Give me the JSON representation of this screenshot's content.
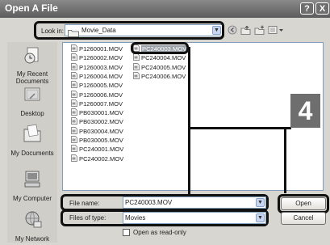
{
  "window": {
    "title": "Open A File",
    "help_label": "?",
    "close_label": "X"
  },
  "toolbar": {
    "lookin_label": "Look in:",
    "lookin_value": "Movie_Data",
    "icons": [
      "back-icon",
      "up-folder-icon",
      "new-folder-icon",
      "views-menu-icon"
    ]
  },
  "places": [
    {
      "label": "My Recent Documents",
      "line1": "My Recent",
      "line2": "Documents",
      "icon": "recent-documents-icon"
    },
    {
      "label": "Desktop",
      "line1": "Desktop",
      "line2": "",
      "icon": "desktop-icon"
    },
    {
      "label": "My Documents",
      "line1": "My Documents",
      "line2": "",
      "icon": "my-documents-icon"
    },
    {
      "label": "My Computer",
      "line1": "My Computer",
      "line2": "",
      "icon": "my-computer-icon"
    },
    {
      "label": "My Network",
      "line1": "My Network",
      "line2": "",
      "icon": "my-network-icon"
    }
  ],
  "files": {
    "column1": [
      "P1260001.MOV",
      "P1260002.MOV",
      "P1260003.MOV",
      "P1260004.MOV",
      "P1260005.MOV",
      "P1260006.MOV",
      "P1260007.MOV",
      "PB030001.MOV",
      "PB030002.MOV",
      "PB030004.MOV",
      "PB030005.MOV",
      "PC240001.MOV",
      "PC240002.MOV"
    ],
    "column2": [
      "PC240003.MOV",
      "PC240004.MOV",
      "PC240005.MOV",
      "PC240006.MOV"
    ],
    "selected": "PC240003.MOV"
  },
  "step_badge": "4",
  "form": {
    "file_name_label": "File name:",
    "file_name_value": "PC240003.MOV",
    "file_type_label": "Files of type:",
    "file_type_value": "Movies",
    "readonly_label": "Open as read-only",
    "readonly_checked": false
  },
  "buttons": {
    "open": "Open",
    "cancel": "Cancel"
  },
  "colors": {
    "callout": "#111111",
    "badge": "#6e6e6e",
    "titlebar": "#6a6a6a",
    "selection": "#9aa0a8"
  }
}
